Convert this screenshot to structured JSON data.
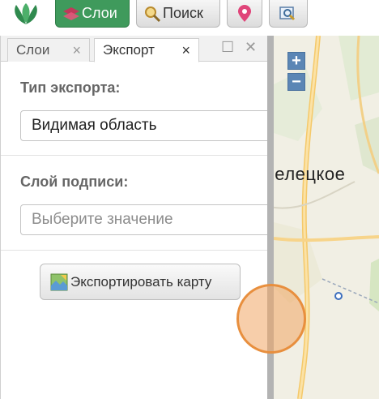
{
  "toolbar": {
    "layers_label": "Слои",
    "search_label": "Поиск"
  },
  "panel": {
    "tabs": [
      {
        "label": "Слои",
        "active": false
      },
      {
        "label": "Экспорт",
        "active": true
      }
    ],
    "export_type": {
      "title": "Тип экспорта:",
      "value": "Видимая область"
    },
    "caption_layer": {
      "title": "Слой подписи:",
      "placeholder": "Выберите значение"
    },
    "export_button_label": "Экспортировать карту"
  },
  "map": {
    "place_label": "трелецкое",
    "zoom_in": "+",
    "zoom_out": "−"
  },
  "colors": {
    "active_tab_green": "#3f9a5c",
    "zoom_blue": "#5b86b5",
    "touch_orange": "#e88f3e"
  }
}
